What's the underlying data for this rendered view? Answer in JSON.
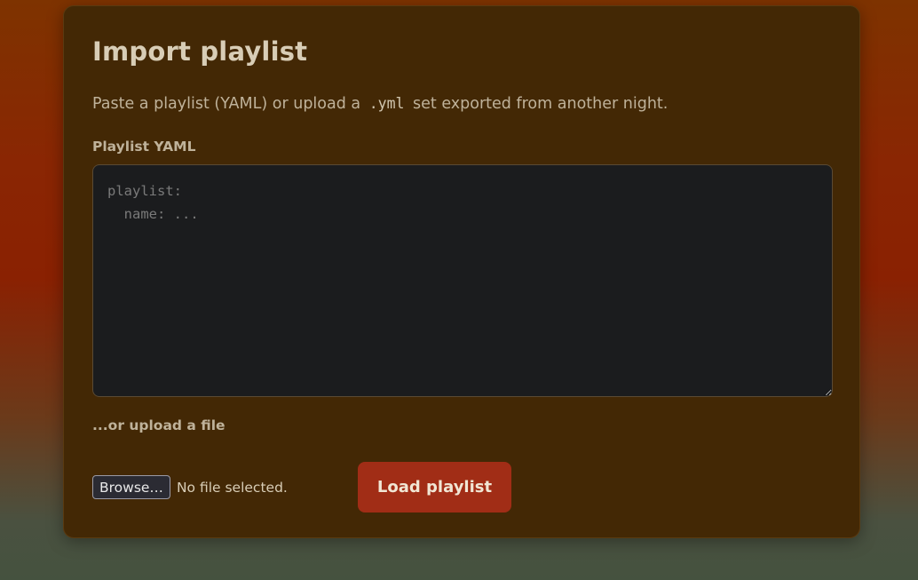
{
  "import_form": {
    "title": "Import playlist",
    "description_before": "Paste a playlist (YAML) or upload a",
    "description_code": ".yml",
    "description_after": "set exported from another night.",
    "yaml_label": "Playlist YAML",
    "yaml_value": "",
    "yaml_placeholder": "playlist:\n  name: ...",
    "upload_label": "...or upload a file",
    "browse_label": "Browse…",
    "file_status": "No file selected.",
    "load_label": "Load playlist"
  },
  "colors": {
    "card_background": "#432805",
    "button_accent": "#a12d16",
    "textarea_background": "#1b1c1e"
  }
}
